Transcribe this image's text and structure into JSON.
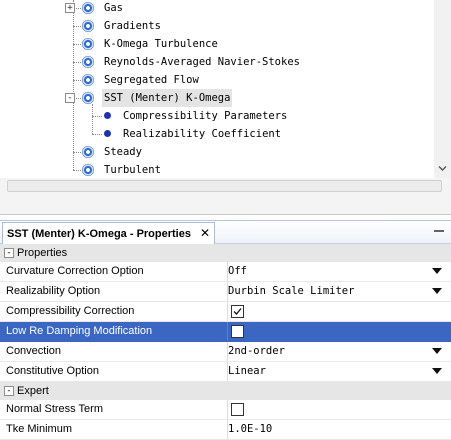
{
  "tree": {
    "items": [
      {
        "label": "Gas",
        "expander": "+"
      },
      {
        "label": "Gradients"
      },
      {
        "label": "K-Omega Turbulence"
      },
      {
        "label": "Reynolds-Averaged Navier-Stokes"
      },
      {
        "label": "Segregated Flow"
      },
      {
        "label": "SST (Menter) K-Omega",
        "expander": "-",
        "selected": true
      },
      {
        "label": "Compressibility Parameters",
        "child": true
      },
      {
        "label": "Realizability Coefficient",
        "child": true
      },
      {
        "label": "Steady"
      },
      {
        "label": "Turbulent"
      }
    ]
  },
  "properties": {
    "tab_title": "SST (Menter) K-Omega - Properties",
    "close_glyph": "✕",
    "minimize_glyph": "—",
    "sections": [
      {
        "title": "Properties",
        "toggle": "-",
        "rows": [
          {
            "name": "Curvature Correction Option",
            "value": "Off",
            "type": "dropdown"
          },
          {
            "name": "Realizability Option",
            "value": "Durbin Scale Limiter",
            "type": "dropdown"
          },
          {
            "name": "Compressibility Correction",
            "checked": true,
            "type": "checkbox"
          },
          {
            "name": "Low Re Damping Modification",
            "checked": false,
            "type": "checkbox",
            "highlighted": true
          },
          {
            "name": "Convection",
            "value": "2nd-order",
            "type": "dropdown"
          },
          {
            "name": "Constitutive Option",
            "value": "Linear",
            "type": "dropdown"
          }
        ]
      },
      {
        "title": "Expert",
        "toggle": "-",
        "rows": [
          {
            "name": "Normal Stress Term",
            "checked": false,
            "type": "checkbox"
          },
          {
            "name": "Tke Minimum",
            "value": "1.0E-10",
            "type": "text"
          }
        ]
      }
    ]
  },
  "colors": {
    "selection_row": "#3b67c3",
    "tree_icon_blue": "#2f6ad0",
    "section_bg": "#e6e6e6"
  },
  "icons": {
    "tree_node": "model-node-icon",
    "tree_leaf": "parameter-dot-icon",
    "dropdown": "chevron-down-icon",
    "checkbox": "checkbox-icon"
  }
}
